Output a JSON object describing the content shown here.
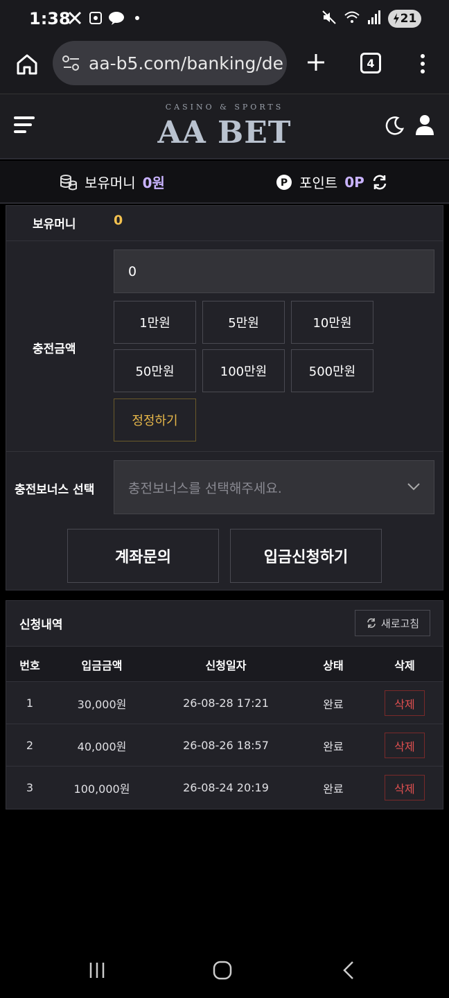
{
  "status_bar": {
    "time": "1:38",
    "battery": "21",
    "notification_icons": [
      "x-icon",
      "screenshot-icon",
      "kakaotalk-icon",
      "dot-icon"
    ],
    "system_icons": [
      "mute-icon",
      "wifi-icon",
      "signal-icon",
      "battery-icon"
    ]
  },
  "browser": {
    "url": "aa-b5.com/banking/de",
    "tab_count": "4"
  },
  "header": {
    "logo_sub": "CASINO & SPORTS",
    "logo_main": "AA BET"
  },
  "wallet": {
    "money_label": "보유머니",
    "money_value": "0원",
    "points_label": "포인트",
    "points_value": "0P"
  },
  "deposit_form": {
    "balance_label": "보유머니",
    "balance_value": "0",
    "amount_label": "충전금액",
    "amount_value": "0",
    "quick_amounts": [
      "1만원",
      "5만원",
      "10만원",
      "50만원",
      "100만원",
      "500만원"
    ],
    "reset_label": "정정하기",
    "bonus_label": "충전보너스 선택",
    "bonus_placeholder": "충전보너스를 선택해주세요.",
    "account_inquiry_label": "계좌문의",
    "submit_label": "입금신청하기"
  },
  "history": {
    "title": "신청내역",
    "refresh_label": "새로고침",
    "columns": [
      "번호",
      "입금금액",
      "신청일자",
      "상태",
      "삭제"
    ],
    "rows": [
      {
        "no": "1",
        "amount": "30,000원",
        "date": "26-08-28 17:21",
        "status": "완료",
        "delete": "삭제"
      },
      {
        "no": "2",
        "amount": "40,000원",
        "date": "26-08-26 18:57",
        "status": "완료",
        "delete": "삭제"
      },
      {
        "no": "3",
        "amount": "100,000원",
        "date": "26-08-24 20:19",
        "status": "완료",
        "delete": "삭제"
      }
    ]
  },
  "colors": {
    "gold": "#f3c14f",
    "purple": "#c9b3ff",
    "delete_red": "#e05050",
    "panel_bg": "#222228"
  }
}
